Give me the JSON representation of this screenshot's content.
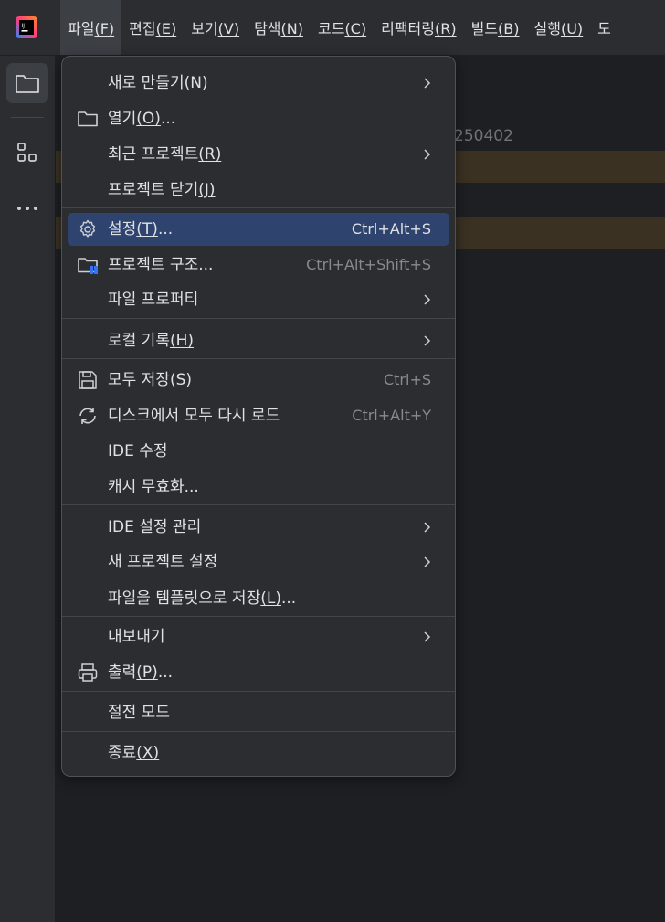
{
  "menubar": {
    "items": [
      {
        "label": "파일",
        "mnemonic": "(F)",
        "active": true
      },
      {
        "label": "편집",
        "mnemonic": "(E)"
      },
      {
        "label": "보기",
        "mnemonic": "(V)"
      },
      {
        "label": "탐색",
        "mnemonic": "(N)"
      },
      {
        "label": "코드",
        "mnemonic": "(C)"
      },
      {
        "label": "리팩터링",
        "mnemonic": "(R)"
      },
      {
        "label": "빌드",
        "mnemonic": "(B)"
      },
      {
        "label": "실행",
        "mnemonic": "(U)"
      },
      {
        "label": "도",
        "mnemonic": ""
      }
    ]
  },
  "editor": {
    "partial_text": "250402"
  },
  "file_menu": {
    "items": [
      {
        "label": "새로 만들기",
        "mnemonic": "(N)",
        "submenu": true
      },
      {
        "label": "열기",
        "mnemonic": "(O)",
        "suffix": "...",
        "icon": "folder-icon"
      },
      {
        "label": "최근 프로젝트",
        "mnemonic": "(R)",
        "submenu": true
      },
      {
        "label": "프로젝트 닫기",
        "mnemonic": "(J)"
      },
      {
        "label": "설정",
        "mnemonic": "(T)",
        "suffix": "...",
        "shortcut": "Ctrl+Alt+S",
        "icon": "gear-icon",
        "selected": true
      },
      {
        "label": "프로젝트 구조...",
        "shortcut": "Ctrl+Alt+Shift+S",
        "icon": "project-structure-icon"
      },
      {
        "label": "파일 프로퍼티",
        "submenu": true
      },
      {
        "label": "로컬 기록",
        "mnemonic": "(H)",
        "submenu": true
      },
      {
        "label": "모두 저장",
        "mnemonic": "(S)",
        "shortcut": "Ctrl+S",
        "icon": "save-icon"
      },
      {
        "label": "디스크에서 모두 다시 로드",
        "shortcut": "Ctrl+Alt+Y",
        "icon": "reload-icon"
      },
      {
        "label": "IDE 수정"
      },
      {
        "label": "캐시 무효화..."
      },
      {
        "label": "IDE 설정 관리",
        "submenu": true
      },
      {
        "label": "새 프로젝트 설정",
        "submenu": true
      },
      {
        "label": "파일을 템플릿으로 저장",
        "mnemonic": "(L)",
        "suffix": "..."
      },
      {
        "label": "내보내기",
        "submenu": true
      },
      {
        "label": "출력",
        "mnemonic": "(P)",
        "suffix": "...",
        "icon": "print-icon"
      },
      {
        "label": "절전 모드"
      },
      {
        "label": "종료",
        "mnemonic": "(X)"
      }
    ]
  },
  "colors": {
    "background": "#1e1f22",
    "panel": "#2b2d30",
    "selection": "#2e436e",
    "highlight_row": "#3a3122",
    "text": "#dfe1e5",
    "shortcut_text": "#868a91"
  }
}
